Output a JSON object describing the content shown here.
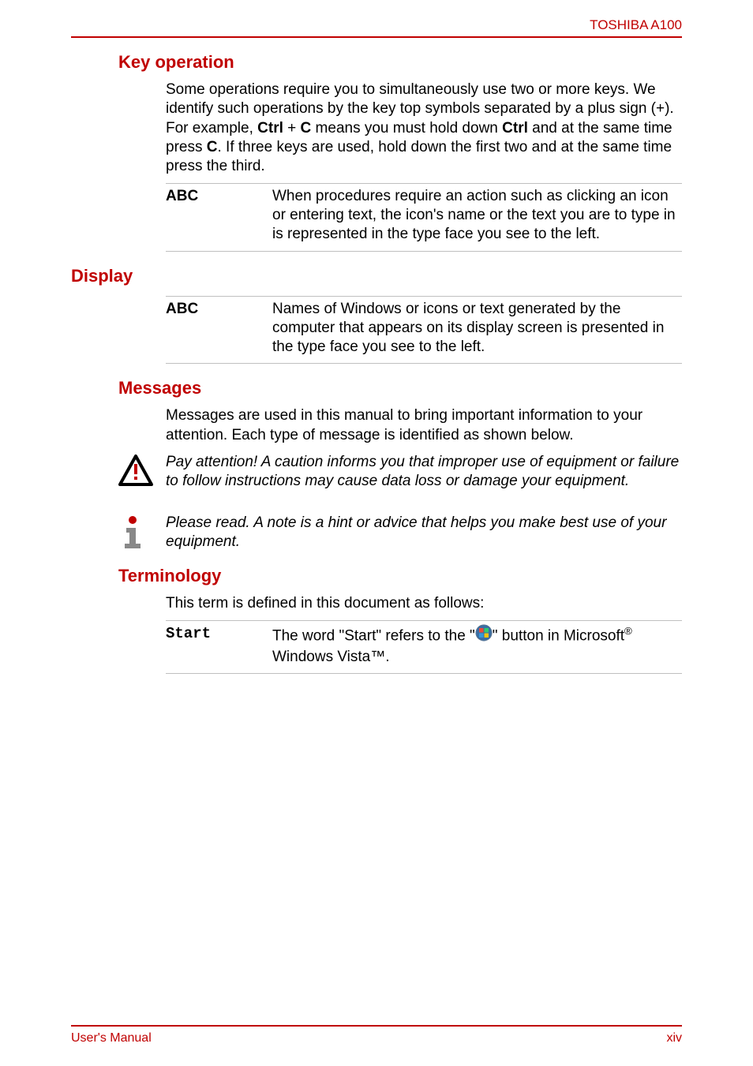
{
  "header": {
    "product": "TOSHIBA A100"
  },
  "footer": {
    "left": "User's Manual",
    "right": "xiv"
  },
  "sections": {
    "key_operation": {
      "title": "Key operation",
      "intro_parts": {
        "p1": "Some operations require you to simultaneously use two or more keys. We identify such operations by the key top symbols separated by a plus sign (+). For example, ",
        "k1": "Ctrl",
        "plus": " + ",
        "k2": "C",
        "p2": " means you must hold down ",
        "k3": "Ctrl",
        "p3": " and at the same time press ",
        "k4": "C",
        "p4": ". If three keys are used, hold down the first two and at the same time press the third."
      },
      "row": {
        "term": "ABC",
        "desc": "When procedures require an action such as clicking an icon or entering text, the icon's name or the text you are to type in is represented in the type face you see to the left."
      }
    },
    "display": {
      "title": "Display",
      "row": {
        "term": "ABC",
        "desc": "Names of Windows or icons or text generated by the computer that appears on its display screen is presented in the type face you see to the left."
      }
    },
    "messages": {
      "title": "Messages",
      "intro": "Messages are used in this manual to bring important information to your attention. Each type of message is identified as shown below.",
      "caution": "Pay attention! A caution informs you that improper use of equipment or failure to follow instructions may cause data loss or damage your equipment.",
      "note": "Please read. A note is a hint or advice that helps you make best use of your equipment."
    },
    "terminology": {
      "title": "Terminology",
      "intro": "This term is defined in this document as follows:",
      "row": {
        "term": "Start",
        "desc_p1": "The word \"Start\" refers to the \"",
        "desc_p2": "\" button in Microsoft",
        "reg": "®",
        "desc_p3": " Windows Vista™."
      }
    }
  }
}
